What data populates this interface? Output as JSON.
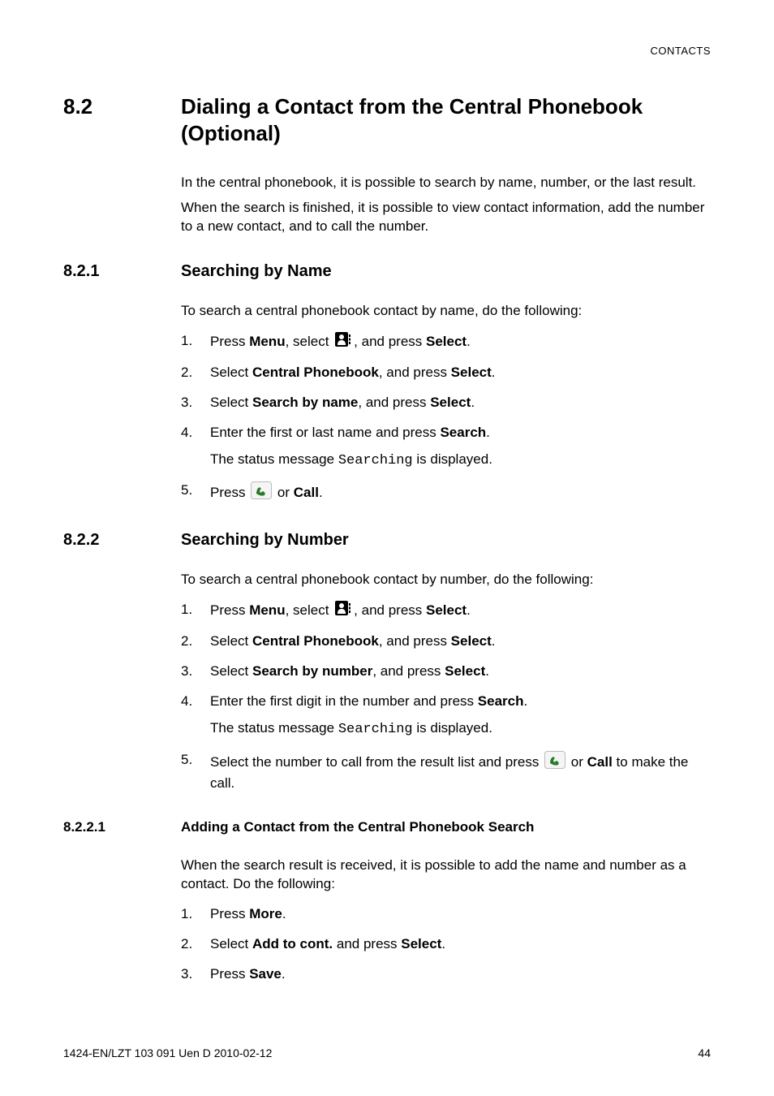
{
  "running_header": "CONTACTS",
  "section": {
    "num": "8.2",
    "title": "Dialing a Contact from the Central Phonebook (Optional)",
    "intro": [
      "In the central phonebook, it is possible to search by name, number, or the last result.",
      "When the search is finished, it is possible to view contact information, add the number to a new contact, and to call the number."
    ]
  },
  "sub1": {
    "num": "8.2.1",
    "title": "Searching by Name",
    "intro": "To search a central phonebook contact by name, do the following:",
    "steps": {
      "s1_pre": "Press ",
      "s1_menu": "Menu",
      "s1_mid": ", select ",
      "s1_post": ", and press ",
      "s1_select": "Select",
      "s1_end": ".",
      "s2_pre": "Select ",
      "s2_b": "Central Phonebook",
      "s2_mid": ", and press ",
      "s2_select": "Select",
      "s2_end": ".",
      "s3_pre": "Select ",
      "s3_b": "Search by name",
      "s3_mid": ", and press ",
      "s3_select": "Select",
      "s3_end": ".",
      "s4_line1_pre": "Enter the first or last name and press ",
      "s4_line1_b": "Search",
      "s4_line1_end": ".",
      "s4_line2_pre": "The status message ",
      "s4_line2_code": "Searching",
      "s4_line2_post": " is displayed.",
      "s5_pre": "Press ",
      "s5_post": " or ",
      "s5_b": "Call",
      "s5_end": "."
    }
  },
  "sub2": {
    "num": "8.2.2",
    "title": "Searching by Number",
    "intro": "To search a central phonebook contact by number, do the following:",
    "steps": {
      "s1_pre": "Press ",
      "s1_menu": "Menu",
      "s1_mid": ", select ",
      "s1_post": ", and press ",
      "s1_select": "Select",
      "s1_end": ".",
      "s2_pre": "Select ",
      "s2_b": "Central Phonebook",
      "s2_mid": ", and press ",
      "s2_select": "Select",
      "s2_end": ".",
      "s3_pre": "Select ",
      "s3_b": "Search by number",
      "s3_mid": ", and press ",
      "s3_select": "Select",
      "s3_end": ".",
      "s4_line1_pre": "Enter the first digit in the number and press ",
      "s4_line1_b": "Search",
      "s4_line1_end": ".",
      "s4_line2_pre": "The status message ",
      "s4_line2_code": "Searching",
      "s4_line2_post": " is displayed.",
      "s5_pre": "Select the number to call from the result list and press ",
      "s5_post": " or ",
      "s5_b": "Call",
      "s5_end": " to make the call."
    }
  },
  "sub3": {
    "num": "8.2.2.1",
    "title": "Adding a Contact from the Central Phonebook Search",
    "intro": "When the search result is received, it is possible to add the name and number as a contact. Do the following:",
    "steps": {
      "s1_pre": "Press ",
      "s1_b": "More",
      "s1_end": ".",
      "s2_pre": "Select ",
      "s2_b": "Add to cont.",
      "s2_mid": " and press ",
      "s2_select": "Select",
      "s2_end": ".",
      "s3_pre": "Press ",
      "s3_b": "Save",
      "s3_end": "."
    }
  },
  "footer": {
    "left": "1424-EN/LZT 103 091 Uen D 2010-02-12",
    "right": "44"
  }
}
